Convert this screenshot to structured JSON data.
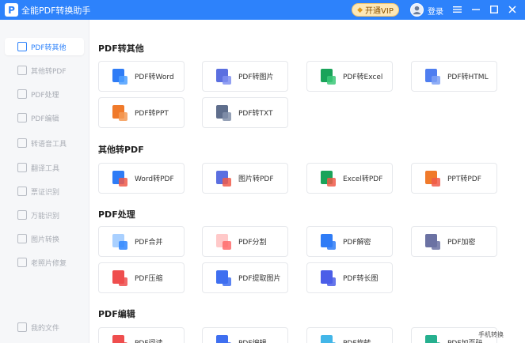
{
  "app": {
    "title": "全能PDF转换助手",
    "logo_letter": "P",
    "vip_label": "开通VIP",
    "login_label": "登录",
    "accent": "#2d82fb"
  },
  "sidebar": {
    "items": [
      {
        "label": "PDF转其他",
        "icon": "pdf-convert-icon",
        "active": true
      },
      {
        "label": "其他转PDF",
        "icon": "to-pdf-icon"
      },
      {
        "label": "PDF处理",
        "icon": "pdf-process-icon"
      },
      {
        "label": "PDF编辑",
        "icon": "pdf-edit-icon"
      },
      {
        "label": "转语音工具",
        "icon": "voice-icon"
      },
      {
        "label": "翻译工具",
        "icon": "translate-icon"
      },
      {
        "label": "票证识别",
        "icon": "ticket-icon"
      },
      {
        "label": "万能识别",
        "icon": "scan-icon"
      },
      {
        "label": "图片转换",
        "icon": "image-icon"
      },
      {
        "label": "老照片修复",
        "icon": "photo-repair-icon"
      }
    ],
    "footer": {
      "label": "我的文件",
      "icon": "folder-icon"
    }
  },
  "sections": [
    {
      "title": "PDF转其他",
      "cards": [
        {
          "label": "PDF转Word",
          "c1": "#2f7cf6",
          "c2": "#4da0ff"
        },
        {
          "label": "PDF转图片",
          "c1": "#5b6fe0",
          "c2": "#7f8ff0"
        },
        {
          "label": "PDF转Excel",
          "c1": "#1aa35a",
          "c2": "#3cc878"
        },
        {
          "label": "PDF转HTML",
          "c1": "#4f7ef0",
          "c2": "#7da0f5"
        },
        {
          "label": "PDF转PPT",
          "c1": "#f07a2b",
          "c2": "#f59a55"
        },
        {
          "label": "PDF转TXT",
          "c1": "#5f6e8c",
          "c2": "#8390aa"
        }
      ]
    },
    {
      "title": "其他转PDF",
      "cards": [
        {
          "label": "Word转PDF",
          "c1": "#2f7cf6",
          "c2": "#f05a4a"
        },
        {
          "label": "图片转PDF",
          "c1": "#5b6fe0",
          "c2": "#f05a4a"
        },
        {
          "label": "Excel转PDF",
          "c1": "#1aa35a",
          "c2": "#f05a4a"
        },
        {
          "label": "PPT转PDF",
          "c1": "#f07a2b",
          "c2": "#f05a4a"
        }
      ]
    },
    {
      "title": "PDF处理",
      "cards": [
        {
          "label": "PDF合并",
          "c1": "#a9d0ff",
          "c2": "#2f86ff"
        },
        {
          "label": "PDF分割",
          "c1": "#ffc9c9",
          "c2": "#ff6b6b"
        },
        {
          "label": "PDF解密",
          "c1": "#2f7cf6",
          "c2": "#2f7cf6"
        },
        {
          "label": "PDF加密",
          "c1": "#6b72a3",
          "c2": "#6b72a3"
        },
        {
          "label": "PDF压缩",
          "c1": "#ef4e4e",
          "c2": "#ef4e4e"
        },
        {
          "label": "PDF提取图片",
          "c1": "#3f6ff0",
          "c2": "#3f6ff0"
        },
        {
          "label": "PDF转长图",
          "c1": "#4b5ee8",
          "c2": "#4b5ee8"
        }
      ]
    },
    {
      "title": "PDF编辑",
      "cards": [
        {
          "label": "PDF阅读",
          "c1": "#ef4e4e",
          "c2": "#ef4e4e"
        },
        {
          "label": "PDF编辑",
          "c1": "#3f6ff0",
          "c2": "#3f6ff0"
        },
        {
          "label": "PDF旋转",
          "c1": "#43b6e8",
          "c2": "#43b6e8"
        },
        {
          "label": "PDF加页码",
          "c1": "#26b08f",
          "c2": "#26b08f"
        }
      ]
    }
  ],
  "corner_text": "手机转换"
}
